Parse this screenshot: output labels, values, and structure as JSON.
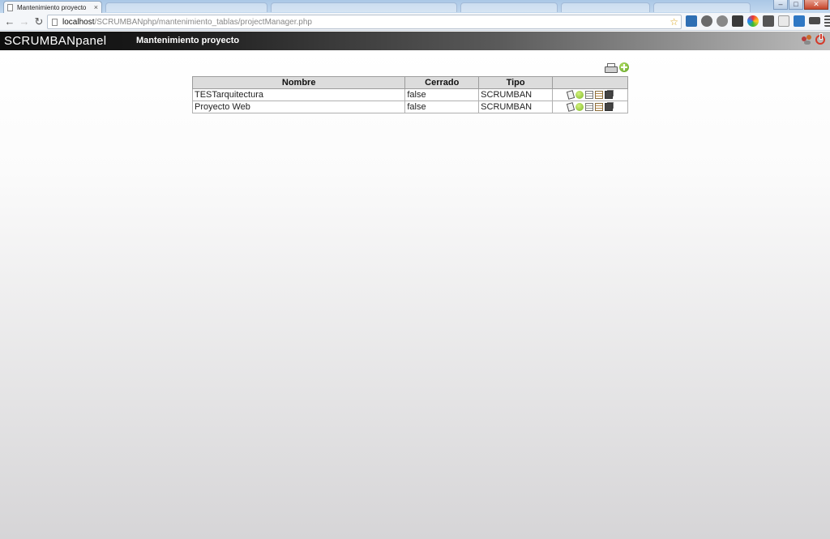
{
  "browser": {
    "tab_title": "Mantenimiento proyecto",
    "tab_close": "×",
    "url_host": "localhost",
    "url_path": "/SCRUMBANphp/mantenimiento_tablas/projectManager.php"
  },
  "header": {
    "brand": "SCRUMBANpanel",
    "title": "Mantenimiento proyecto"
  },
  "table": {
    "columns": [
      "Nombre",
      "Cerrado",
      "Tipo",
      ""
    ],
    "rows": [
      {
        "nombre": "TESTarquitectura",
        "cerrado": "false",
        "tipo": "SCRUMBAN"
      },
      {
        "nombre": "Proyecto Web",
        "cerrado": "false",
        "tipo": "SCRUMBAN"
      }
    ]
  },
  "colors": {
    "header_dark": "#0d0d0d",
    "table_header_bg": "#dcdcdc",
    "add_green": "#5a9d1e"
  }
}
